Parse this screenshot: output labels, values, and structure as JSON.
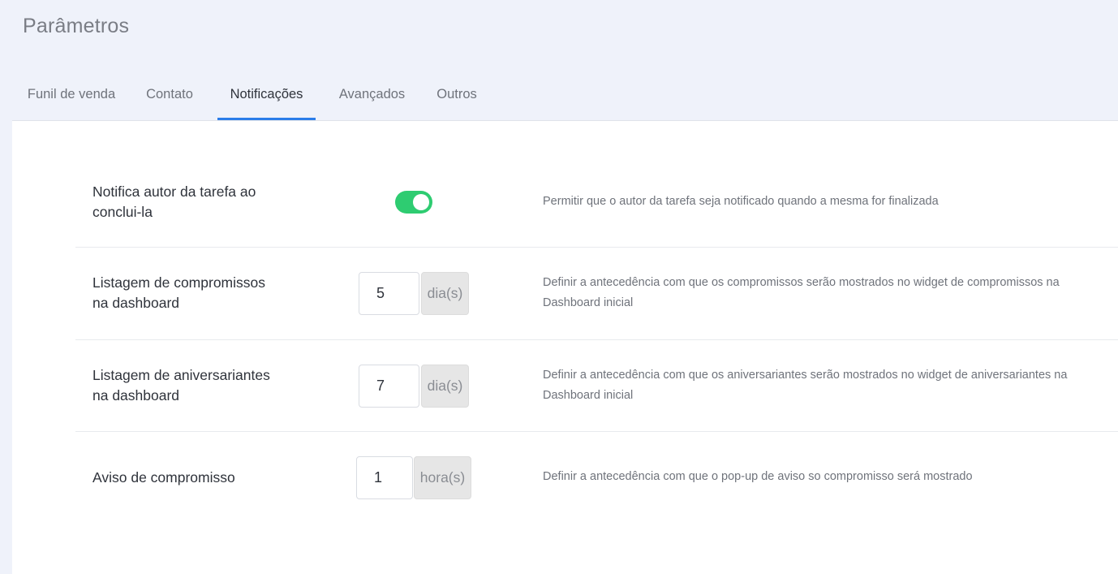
{
  "page": {
    "title": "Parâmetros"
  },
  "tabs": [
    {
      "label": "Funil de venda",
      "active": false
    },
    {
      "label": "Contato",
      "active": false
    },
    {
      "label": "Notificações",
      "active": true
    },
    {
      "label": "Avançados",
      "active": false
    },
    {
      "label": "Outros",
      "active": false
    }
  ],
  "settings": [
    {
      "label_line1": "Notifica autor da tarefa ao",
      "label_line2": "conclui-la",
      "control": "toggle",
      "enabled": true,
      "description": "Permitir que o autor da tarefa seja notificado quando a mesma for finalizada"
    },
    {
      "label_line1": "Listagem de compromissos",
      "label_line2": "na dashboard",
      "control": "number",
      "value": "5",
      "unit": "dia(s)",
      "description_line1": "Definir a antecedência com que os compromissos serão mostrados no widget de compromissos na",
      "description_line2": "Dashboard inicial"
    },
    {
      "label_line1": "Listagem de aniversariantes",
      "label_line2": "na dashboard",
      "control": "number",
      "value": "7",
      "unit": "dia(s)",
      "description_line1": "Definir a antecedência com que os aniversariantes serão mostrados no widget de aniversariantes na",
      "description_line2": "Dashboard inicial"
    },
    {
      "label_line1": "Aviso de compromisso",
      "control": "number",
      "value": "1",
      "unit": "hora(s)",
      "description": "Definir a antecedência com que o pop-up de aviso so compromisso será mostrado"
    }
  ],
  "colors": {
    "accent": "#2b7de9",
    "toggle_on": "#2ecc71",
    "header_bg": "#eff2fa"
  }
}
